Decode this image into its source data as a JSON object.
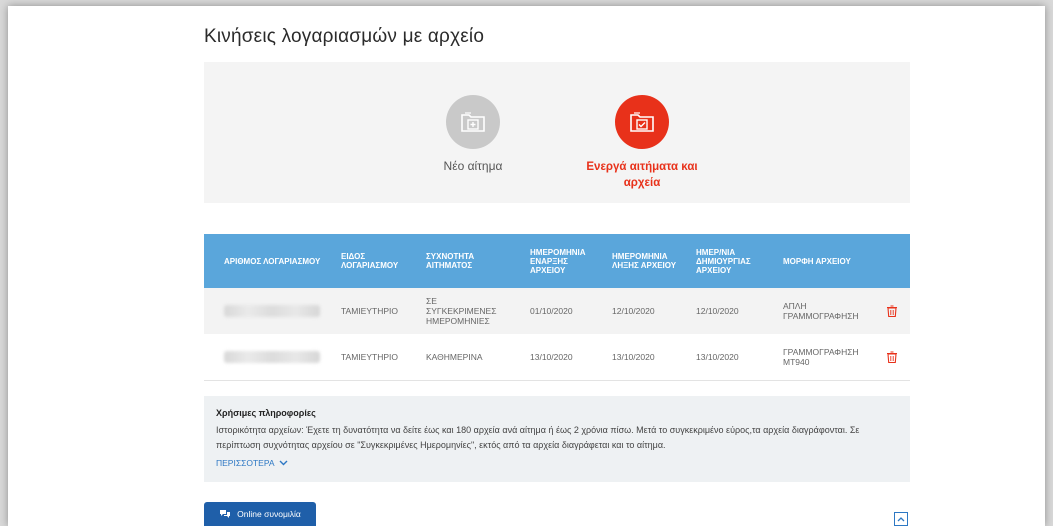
{
  "page": {
    "title": "Κινήσεις λογαριασμών με αρχείο"
  },
  "options": {
    "new_request": {
      "label": "Νέο αίτημα",
      "icon": "folder-plus-icon",
      "color": "#c9c9c9"
    },
    "active_requests": {
      "label": "Ενεργά αιτήματα και αρχεία",
      "icon": "folder-check-icon",
      "color": "#e8311a"
    }
  },
  "table": {
    "header_color": "#5aa6db",
    "columns": [
      "ΑΡΙΘΜΟΣ ΛΟΓΑΡΙΑΣΜΟΥ",
      "ΕΙΔΟΣ ΛΟΓΑΡΙΑΣΜΟΥ",
      "ΣΥΧΝΟΤΗΤΑ ΑΙΤΗΜΑΤΟΣ",
      "ΗΜΕΡΟΜΗΝΙΑ ΕΝΑΡΞΗΣ ΑΡΧΕΙΟΥ",
      "ΗΜΕΡΟΜΗΝΙΑ ΛΗΞΗΣ ΑΡΧΕΙΟΥ",
      "ΗΜΕΡ/ΝΙΑ ΔΗΜΙΟΥΡΓΙΑΣ ΑΡΧΕΙΟΥ",
      "ΜΟΡΦΗ ΑΡΧΕΙΟΥ"
    ],
    "rows": [
      {
        "account_type": "ΤΑΜΙΕΥΤΗΡΙΟ",
        "frequency": "ΣΕ ΣΥΓΚΕΚΡΙΜΕΝΕΣ ΗΜΕΡΟΜΗΝΙΕΣ",
        "start_date": "01/10/2020",
        "end_date": "12/10/2020",
        "created_date": "12/10/2020",
        "file_format": "ΑΠΛΗ ΓΡΑΜΜΟΓΡΑΦΗΣΗ"
      },
      {
        "account_type": "ΤΑΜΙΕΥΤΗΡΙΟ",
        "frequency": "ΚΑΘΗΜΕΡΙΝΑ",
        "start_date": "13/10/2020",
        "end_date": "13/10/2020",
        "created_date": "13/10/2020",
        "file_format": "ΓΡΑΜΜΟΓΡΑΦΗΣΗ MT940"
      }
    ]
  },
  "info": {
    "title": "Χρήσιμες πληροφορίες",
    "text": "Ιστορικότητα αρχείων: Έχετε τη δυνατότητα να δείτε έως και 180 αρχεία ανά αίτημα ή έως 2 χρόνια πίσω. Μετά το συγκεκριμένο εύρος,τα αρχεία διαγράφονται. Σε περίπτωση συχνότητας αρχείου σε \"Συγκεκριμένες Ημερομηνίες\", εκτός από τα αρχεία διαγράφεται και το αίτημα.",
    "more_label": "ΠΕΡΙΣΣΟΤΕΡΑ"
  },
  "chat": {
    "label": "Online συνομιλία"
  },
  "colors": {
    "accent": "#e8311a",
    "link": "#2d78c4",
    "chat": "#1f5fa9"
  }
}
